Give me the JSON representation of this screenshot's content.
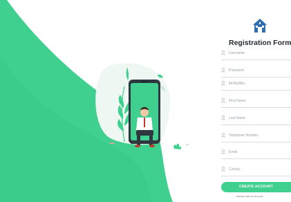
{
  "form": {
    "title": "Registration Form",
    "icon": "house-logo-icon",
    "fields": [
      {
        "placeholder": "Username",
        "icon": "user-icon"
      },
      {
        "placeholder": "Password",
        "icon": "user-icon"
      },
      {
        "placeholder": "Mr/Ms/Mrs",
        "icon": "user-icon"
      },
      {
        "placeholder": "First Name",
        "icon": "user-icon"
      },
      {
        "placeholder": "Last Name",
        "icon": "user-icon"
      },
      {
        "placeholder": "Telephone Number",
        "icon": "user-icon"
      },
      {
        "placeholder": "Email",
        "icon": "user-icon"
      },
      {
        "placeholder": "County",
        "icon": "user-icon"
      }
    ],
    "submit_label": "CREATE ACCOUNT",
    "signin_text": "Already have an account"
  },
  "colors": {
    "accent": "#3fcf8e",
    "accent_dark": "#2fb378",
    "title": "#222b33"
  }
}
